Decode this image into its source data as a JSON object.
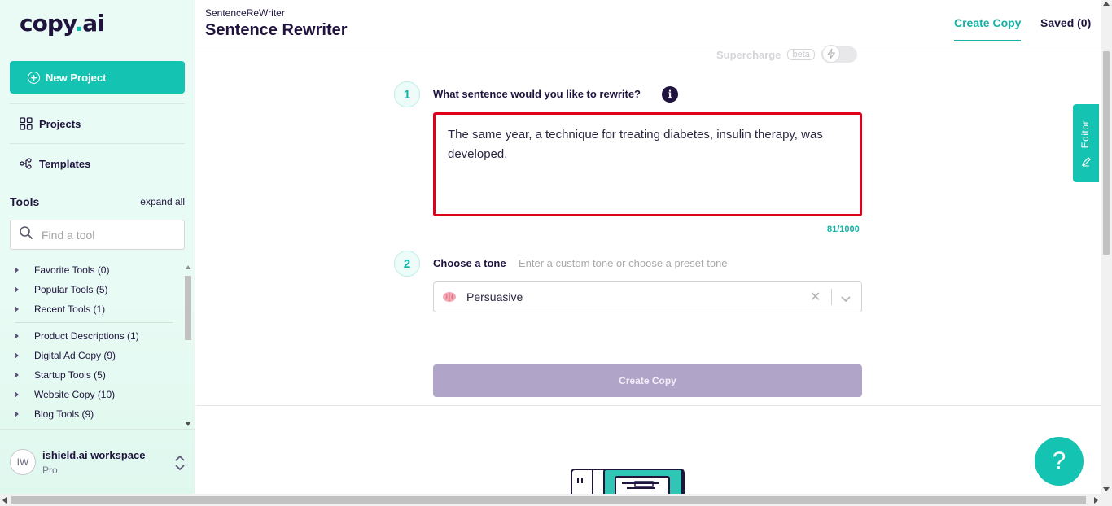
{
  "brand": {
    "logo_a": "copy",
    "logo_dot": ".",
    "logo_b": "ai"
  },
  "sidebar": {
    "new_project": "New Project",
    "nav": [
      {
        "label": "Projects",
        "icon": "grid-icon"
      },
      {
        "label": "Templates",
        "icon": "templates-icon"
      }
    ],
    "tools_title": "Tools",
    "expand_all": "expand all",
    "search_placeholder": "Find a tool",
    "tools": [
      "Favorite Tools (0)",
      "Popular Tools (5)",
      "Recent Tools (1)",
      "Product Descriptions (1)",
      "Digital Ad Copy (9)",
      "Startup Tools (5)",
      "Website Copy (10)",
      "Blog Tools (9)"
    ],
    "workspace": {
      "initials": "IW",
      "name": "ishield.ai workspace",
      "plan": "Pro"
    }
  },
  "header": {
    "breadcrumb": "SentenceReWriter",
    "title": "Sentence Rewriter",
    "tab_create": "Create Copy",
    "tab_saved": "Saved (0)"
  },
  "main": {
    "supercharge_label": "Supercharge",
    "beta_label": "beta",
    "supercharge_on": false,
    "step1_number": "1",
    "step1_label": "What sentence would you like to rewrite?",
    "info_glyph": "i",
    "sentence_value": "The same year, a technique for treating diabetes, insulin therapy, was developed.",
    "char_count": "81/1000",
    "step2_number": "2",
    "step2_label": "Choose a tone",
    "tone_hint": "Enter a custom tone or choose a preset tone",
    "tone_value": "Persuasive",
    "tone_icon": "brain-icon",
    "create_button": "Create Copy",
    "editor_tab": "Editor",
    "help_glyph": "?"
  },
  "colors": {
    "accent": "#14c3b2",
    "dark": "#20143f",
    "highlight_border": "#e0001b",
    "button_disabled": "#b0a4c8"
  }
}
